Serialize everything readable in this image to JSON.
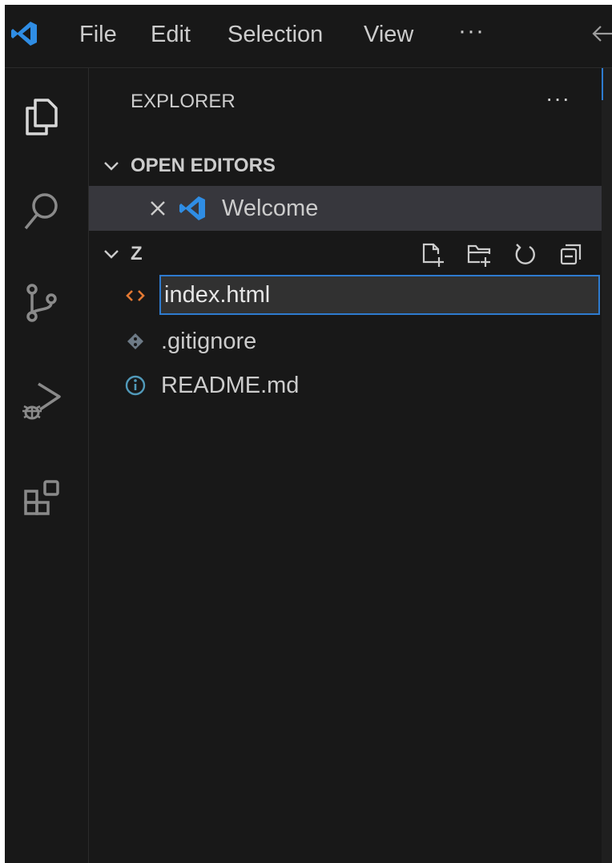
{
  "menu": {
    "file": "File",
    "edit": "Edit",
    "selection": "Selection",
    "view": "View",
    "more": "···"
  },
  "activity_bar": [
    {
      "icon": "explorer-icon"
    },
    {
      "icon": "search-icon"
    },
    {
      "icon": "source-control-icon"
    },
    {
      "icon": "run-debug-icon"
    },
    {
      "icon": "extensions-icon"
    }
  ],
  "explorer": {
    "title": "EXPLORER",
    "more": "···",
    "open_editors": {
      "label": "OPEN EDITORS",
      "items": [
        {
          "label": "Welcome",
          "icon": "vscode-icon"
        }
      ]
    },
    "folder": {
      "label": "Z",
      "actions": [
        "new-file-icon",
        "new-folder-icon",
        "refresh-icon",
        "collapse-all-icon"
      ],
      "files": [
        {
          "label": "index.html",
          "icon": "html-file-icon",
          "editing": true
        },
        {
          "label": ".gitignore",
          "icon": "git-file-icon"
        },
        {
          "label": "README.md",
          "icon": "info-file-icon"
        }
      ]
    }
  },
  "colors": {
    "background": "#181818",
    "selected_row": "#37373d",
    "accent": "#2e7bcf",
    "html_icon": "#e37933",
    "info_icon": "#519aba",
    "text": "#cccccc"
  }
}
